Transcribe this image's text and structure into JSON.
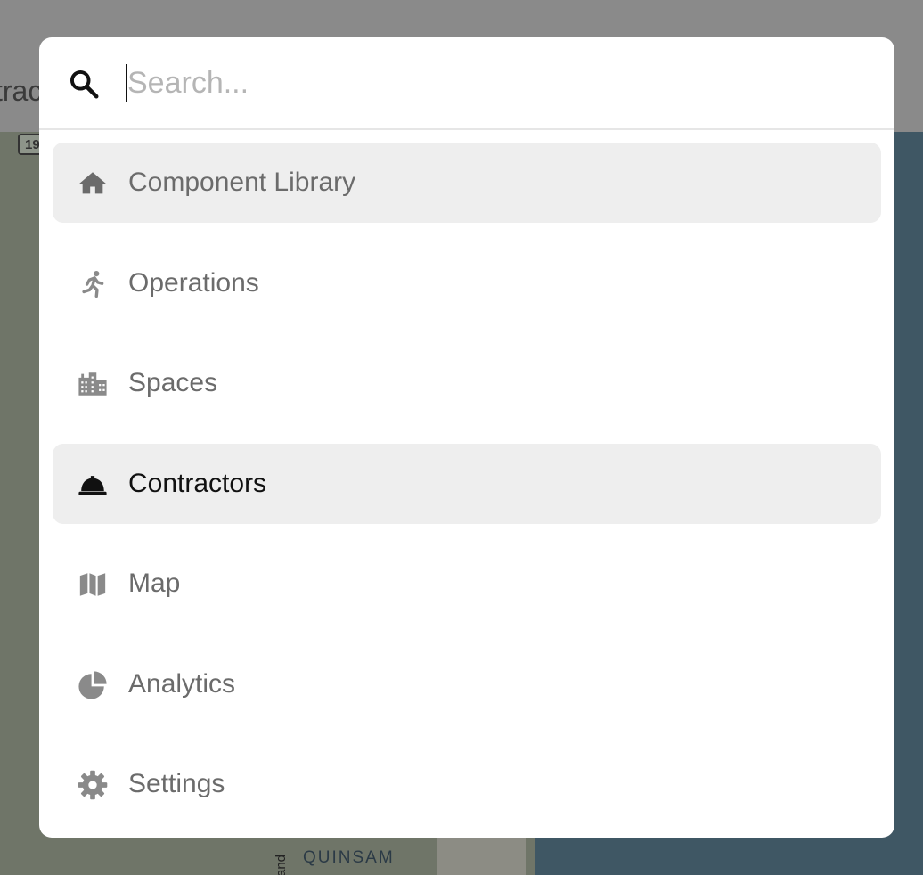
{
  "background": {
    "header_fragment": "trac",
    "route_badge": "19",
    "map_label": "QUINSAM",
    "road_label": "and"
  },
  "search": {
    "placeholder": "Search...",
    "value": "",
    "icon": "search-icon"
  },
  "menu": {
    "items": [
      {
        "label": "Component Library",
        "icon": "home-icon",
        "state": "hovered"
      },
      {
        "label": "Operations",
        "icon": "running-person-icon",
        "state": "normal"
      },
      {
        "label": "Spaces",
        "icon": "buildings-icon",
        "state": "normal"
      },
      {
        "label": "Contractors",
        "icon": "hard-hat-icon",
        "state": "selected"
      },
      {
        "label": "Map",
        "icon": "map-icon",
        "state": "normal"
      },
      {
        "label": "Analytics",
        "icon": "pie-chart-icon",
        "state": "normal"
      },
      {
        "label": "Settings",
        "icon": "gear-icon",
        "state": "normal"
      }
    ]
  },
  "colors": {
    "overlay": "#7f7f7f",
    "panel": "#ffffff",
    "item_highlight": "#eeeeee",
    "text_muted": "#6b6b6b",
    "text_active": "#111111",
    "placeholder": "#b5b5b5"
  }
}
